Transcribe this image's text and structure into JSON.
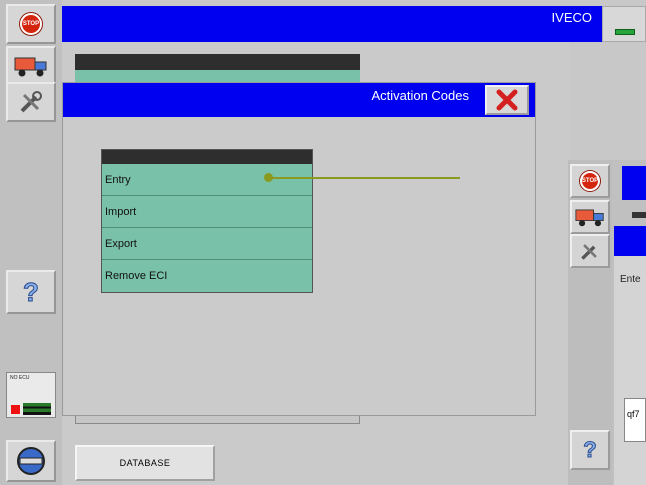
{
  "left_toolbar": {
    "stop_label": "STOP",
    "icons": [
      "stop-icon",
      "truck-icon",
      "tools-icon",
      "help-icon",
      "ignition-key-icon"
    ]
  },
  "top_bar": {
    "brand": "IVECO"
  },
  "status_panel": {
    "label": "NO ECU"
  },
  "dialog": {
    "title": "Activation Codes",
    "menu": [
      "Entry",
      "Import",
      "Export",
      "Remove ECI"
    ]
  },
  "bottom": {
    "database_button": "DATABASE"
  },
  "secondary_window": {
    "stop_label": "STOP",
    "enter_label": "Ente",
    "input_value": "qf7"
  },
  "colors": {
    "title_bar": "#0000f0",
    "menu_row": "#79c1a8",
    "pointer": "#8a9a20"
  }
}
